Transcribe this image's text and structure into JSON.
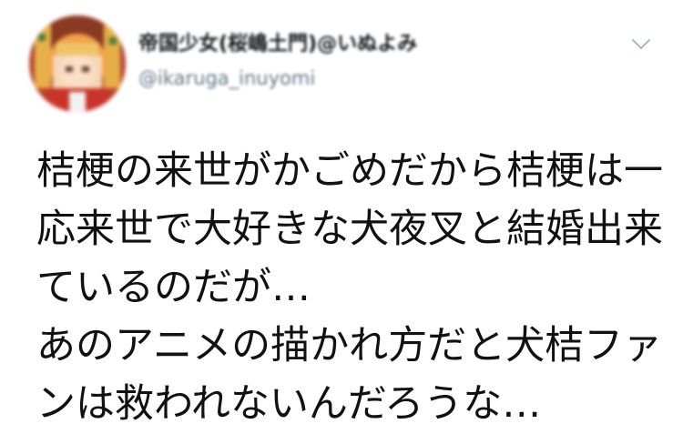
{
  "author": {
    "display_name": "帝国少女(桜嶋土門)@いぬよみ",
    "handle": "@ikaruga_inuyomi",
    "avatar_icon": "blurred-profile-picture"
  },
  "menu": {
    "icon": "chevron-down-icon"
  },
  "tweet": {
    "lines": [
      "桔梗の来世がかごめだから桔梗は一",
      "応来世で大好きな犬夜叉と結婚出来",
      "ているのだが…",
      "あのアニメの描かれ方だと犬桔ファ",
      "ンは救われないんだろうな…"
    ]
  },
  "colors": {
    "text": "#111111",
    "secondary": "#657786",
    "caret": "#aab8c2",
    "background": "#ffffff"
  }
}
